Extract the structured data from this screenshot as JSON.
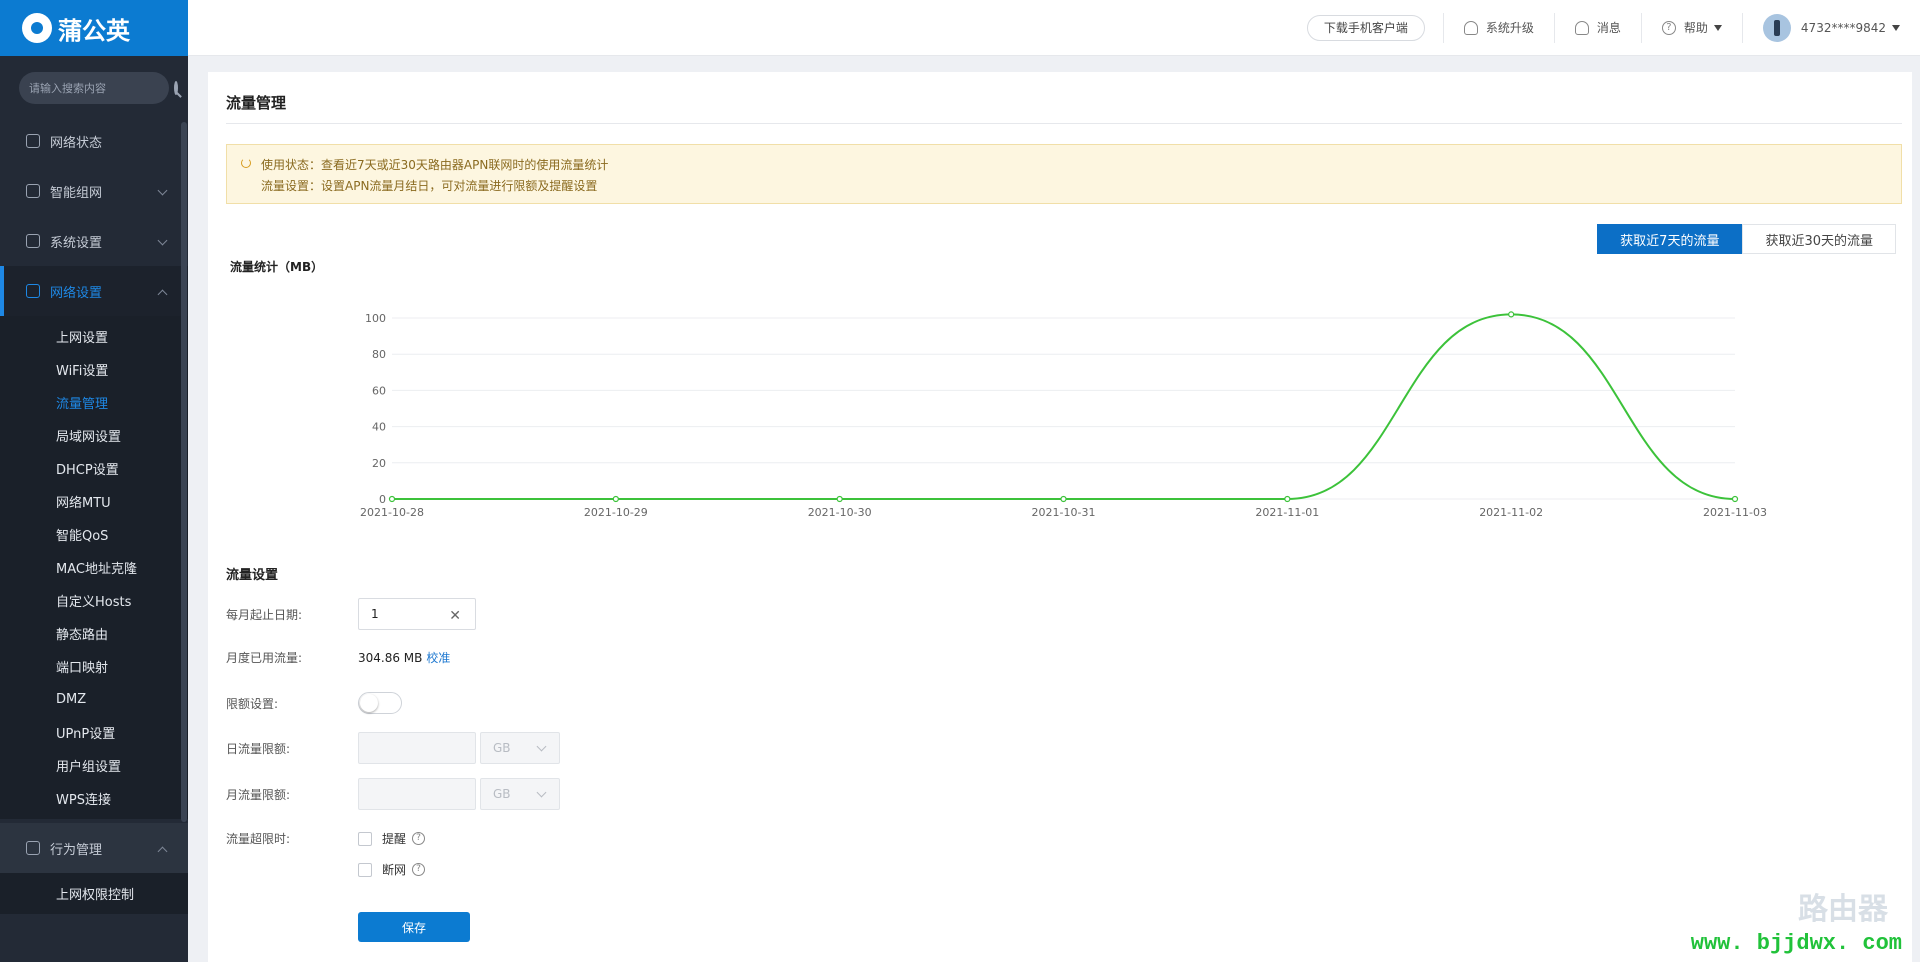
{
  "app": {
    "logo_text": "蒲公英"
  },
  "search": {
    "placeholder": "请输入搜索内容"
  },
  "sidebar": {
    "items": [
      {
        "label": "网络状态"
      },
      {
        "label": "智能组网"
      },
      {
        "label": "系统设置"
      },
      {
        "label": "网络设置"
      }
    ],
    "subitems": [
      "上网设置",
      "WiFi设置",
      "流量管理",
      "局域网设置",
      "DHCP设置",
      "网络MTU",
      "智能QoS",
      "MAC地址克隆",
      "自定义Hosts",
      "静态路由",
      "端口映射",
      "DMZ",
      "UPnP设置",
      "用户组设置",
      "WPS连接"
    ],
    "active_sub": "流量管理",
    "group2": {
      "label": "行为管理",
      "sub": "上网权限控制"
    }
  },
  "header": {
    "download_app": "下载手机客户端",
    "upgrade": "系统升级",
    "messages": "消息",
    "help": "帮助",
    "user": "4732****9842"
  },
  "page": {
    "title": "流量管理",
    "notice_line1": "使用状态：查看近7天或近30天路由器APN联网时的使用流量统计",
    "notice_line2": "流量设置：设置APN流量月结日，可对流量进行限额及提醒设置",
    "tab_7": "获取近7天的流量",
    "tab_30": "获取近30天的流量",
    "chart_title": "流量统计（MB）"
  },
  "chart_data": {
    "type": "line",
    "title": "流量统计（MB）",
    "categories": [
      "2021-10-28",
      "2021-10-29",
      "2021-10-30",
      "2021-10-31",
      "2021-11-01",
      "2021-11-02",
      "2021-11-03"
    ],
    "series": [
      {
        "values": [
          0,
          0,
          0,
          0,
          0,
          102,
          0
        ]
      }
    ],
    "yticks": [
      0,
      20,
      40,
      60,
      80,
      100
    ],
    "ylim": [
      0,
      100
    ],
    "grid": true,
    "line_color": "#3cc23a"
  },
  "form": {
    "section_title": "流量设置",
    "month_start_label": "每月起止日期:",
    "month_start_value": "1",
    "monthly_used_label": "月度已用流量:",
    "monthly_used_value": "304.86 MB",
    "calibrate": "校准",
    "limit_label": "限额设置:",
    "daily_limit_label": "日流量限额:",
    "monthly_limit_label": "月流量限额:",
    "unit": "GB",
    "exceed_label": "流量超限时:",
    "remind": "提醒",
    "disconnect": "断网",
    "save": "保存"
  },
  "watermark": {
    "logo": "路由器",
    "url": "www. bjjdwx. com"
  }
}
